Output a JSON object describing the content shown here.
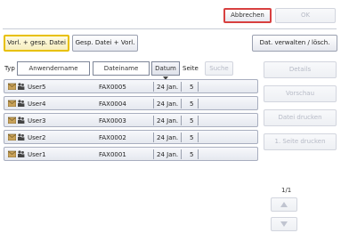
{
  "top_buttons": {
    "cancel_label": "Abbrechen",
    "ok_label": "OK"
  },
  "tabs": [
    {
      "label": "Vorl. + gesp. Datei"
    },
    {
      "label": "Gesp. Datei + Vorl."
    },
    {
      "label": "Dat. verwalten / lösch."
    }
  ],
  "table": {
    "type_label": "Typ",
    "headers": [
      "Anwendername",
      "Dateiname",
      "Datum",
      "Seite"
    ],
    "sort_disabled_label": "Suche",
    "rows": [
      {
        "user": "User5",
        "file": "FAX0005",
        "date": "24 Jan.",
        "pages": "5"
      },
      {
        "user": "User4",
        "file": "FAX0004",
        "date": "24 Jan.",
        "pages": "5"
      },
      {
        "user": "User3",
        "file": "FAX0003",
        "date": "24 Jan.",
        "pages": "5"
      },
      {
        "user": "User2",
        "file": "FAX0002",
        "date": "24 Jan.",
        "pages": "5"
      },
      {
        "user": "User1",
        "file": "FAX0001",
        "date": "24 Jan.",
        "pages": "5"
      }
    ]
  },
  "actions": [
    {
      "label": "Details"
    },
    {
      "label": "Vorschau"
    },
    {
      "label": "Datei drucken"
    },
    {
      "label": "1. Seite drucken"
    }
  ],
  "pager": {
    "text": "1/1"
  },
  "icons": {
    "up": "triangle-up-icon",
    "down": "triangle-down-icon",
    "sort": "sort-down-icon"
  },
  "colors": {
    "cancel_border": "#d84040",
    "active_tab_border": "#e8c000"
  }
}
